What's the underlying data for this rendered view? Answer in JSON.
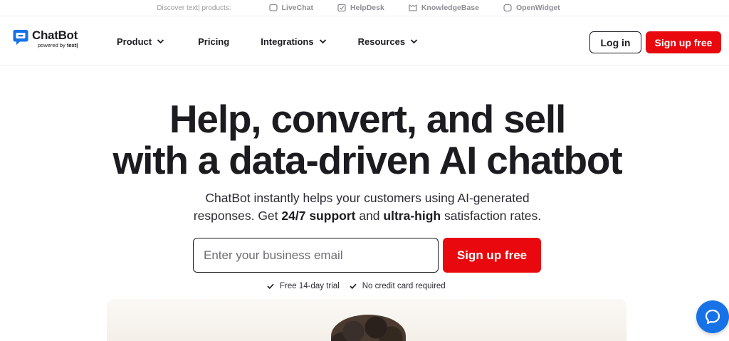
{
  "discover": {
    "label": "Discover text| products:",
    "products": [
      {
        "name": "LiveChat",
        "icon": "livechat-icon"
      },
      {
        "name": "HelpDesk",
        "icon": "helpdesk-icon"
      },
      {
        "name": "KnowledgeBase",
        "icon": "knowledgebase-icon"
      },
      {
        "name": "OpenWidget",
        "icon": "openwidget-icon"
      }
    ]
  },
  "header": {
    "logo_name": "ChatBot",
    "logo_sub_prefix": "powered by ",
    "logo_sub_brand": "text|",
    "nav": [
      {
        "label": "Product",
        "has_dropdown": true
      },
      {
        "label": "Pricing",
        "has_dropdown": false
      },
      {
        "label": "Integrations",
        "has_dropdown": true
      },
      {
        "label": "Resources",
        "has_dropdown": true
      }
    ],
    "login_label": "Log in",
    "signup_label": "Sign up free"
  },
  "hero": {
    "title_line1": "Help, convert, and sell",
    "title_line2": "with a data-driven AI chatbot",
    "sub_part1": "ChatBot instantly helps your customers using AI-generated",
    "sub_part2": "responses. Get ",
    "sub_bold1": "24/7 support",
    "sub_part3": " and ",
    "sub_bold2": "ultra-high",
    "sub_part4": " satisfaction rates.",
    "email_placeholder": "Enter your business email",
    "signup_label": "Sign up free",
    "perks": [
      "Free 14-day trial",
      "No credit card required"
    ]
  },
  "colors": {
    "accent_red": "#e8080d",
    "chat_blue": "#1672e6",
    "text_dark": "#1b1b20"
  }
}
